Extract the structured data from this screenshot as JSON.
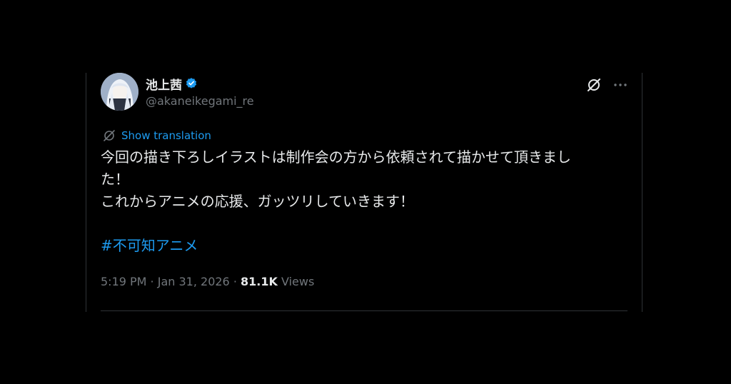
{
  "user": {
    "display_name": "池上茜",
    "handle": "@akaneikegami_re",
    "verified": true
  },
  "actions": {
    "grok_icon": "grok-slash-icon",
    "more_icon": "more-horizontal-icon"
  },
  "translation": {
    "label": "Show translation"
  },
  "tweet": {
    "lines": [
      "今回の描き下ろしイラストは制作会の方から依頼されて描かせて頂きまし",
      "た！",
      "これからアニメの応援、ガッツリしていきます！"
    ],
    "hashtag": "#不可知アニメ"
  },
  "meta": {
    "time": "5:19 PM",
    "separator": " · ",
    "date": "Jan 31, 2026",
    "views_count": "81.1K",
    "views_label": "Views"
  },
  "colors": {
    "background": "#000000",
    "text": "#e7e9ea",
    "secondary": "#71767b",
    "accent": "#1d9bf0",
    "border": "#2f3336"
  }
}
